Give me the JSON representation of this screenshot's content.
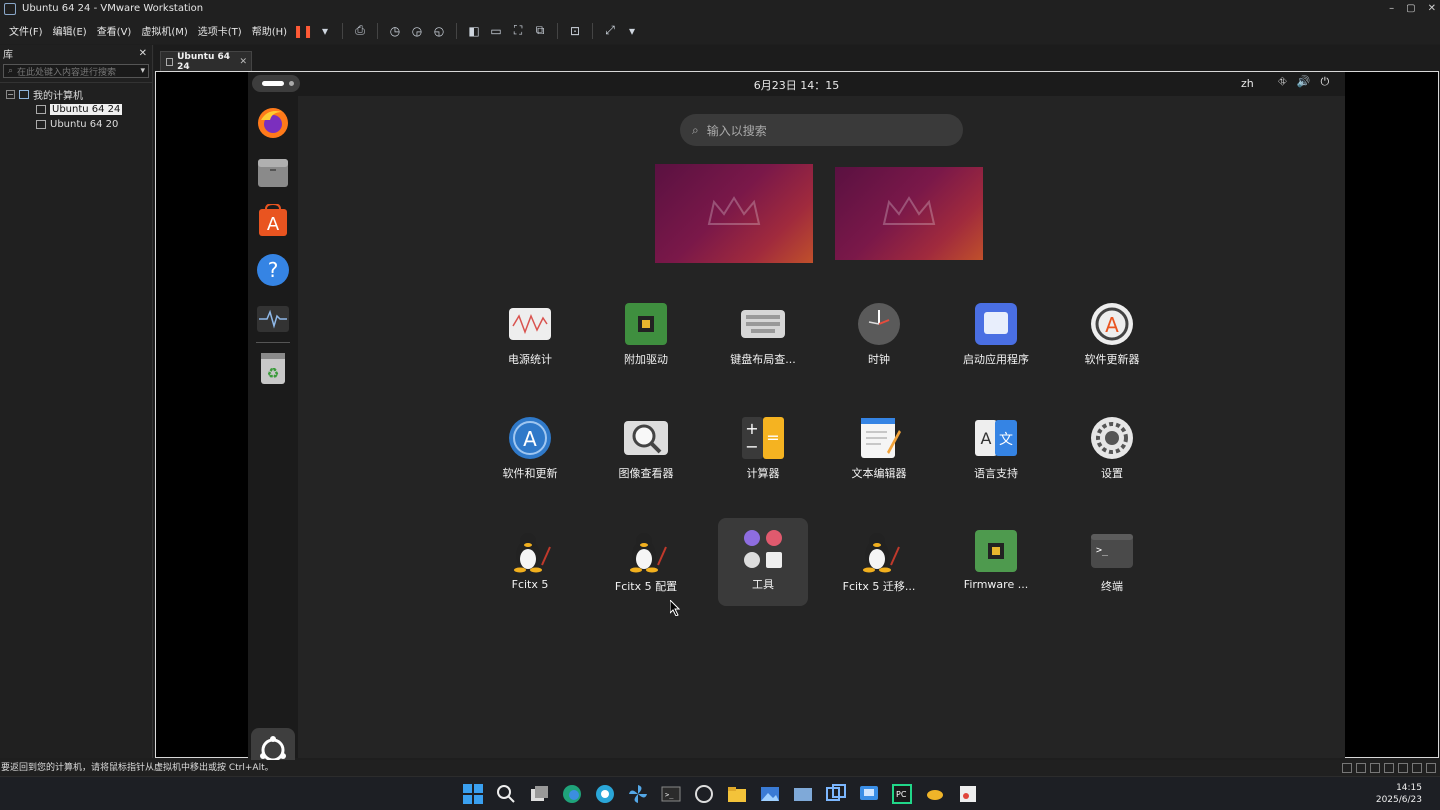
{
  "window": {
    "title": "Ubuntu 64 24 - VMware Workstation",
    "min": "–",
    "max": "▢",
    "close": "✕"
  },
  "menu": [
    "文件(F)",
    "编辑(E)",
    "查看(V)",
    "虚拟机(M)",
    "选项卡(T)",
    "帮助(H)"
  ],
  "library": {
    "title": "库",
    "close": "✕",
    "search_placeholder": "在此处键入内容进行搜索",
    "root": "我的计算机",
    "vms": [
      "Ubuntu 64 24",
      "Ubuntu 64 20"
    ]
  },
  "tab": {
    "label": "Ubuntu 64 24",
    "close": "✕"
  },
  "guest": {
    "clock": "6月23日  14：15",
    "lang": "zh",
    "search_placeholder": "输入以搜索",
    "apps": [
      "电源统计",
      "附加驱动",
      "键盘布局查...",
      "时钟",
      "启动应用程序",
      "软件更新器",
      "软件和更新",
      "图像查看器",
      "计算器",
      "文本编辑器",
      "语言支持",
      "设置",
      "Fcitx 5",
      "Fcitx 5 配置",
      "工具",
      "Fcitx 5 迁移...",
      "Firmware ...",
      "终端"
    ]
  },
  "status": {
    "message": "要返回到您的计算机，请将鼠标指针从虚拟机中移出或按 Ctrl+Alt。"
  },
  "taskbar": {
    "time": "14:15",
    "date": "2025/6/23"
  },
  "colors": {
    "accent": "#e95420",
    "bg": "#242424",
    "dock": "#1b1b1b"
  }
}
